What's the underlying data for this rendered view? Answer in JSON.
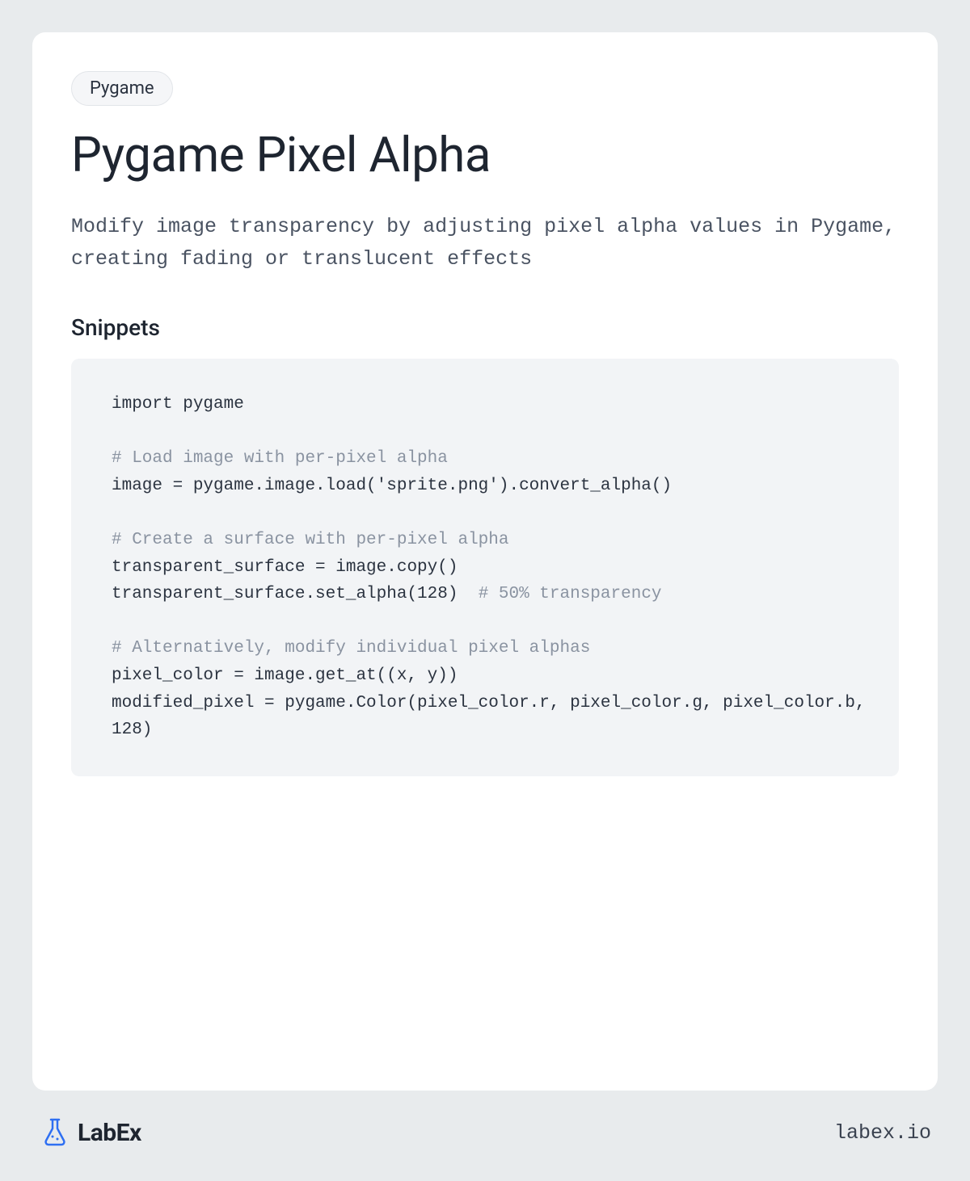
{
  "tag": "Pygame",
  "title": "Pygame Pixel Alpha",
  "description": "Modify image transparency by adjusting pixel alpha values in Pygame, creating fading or translucent effects",
  "section_title": "Snippets",
  "code": {
    "line1": "import pygame",
    "comment1": "# Load image with per-pixel alpha",
    "line2": "image = pygame.image.load('sprite.png').convert_alpha()",
    "comment2": "# Create a surface with per-pixel alpha",
    "line3": "transparent_surface = image.copy()",
    "line4a": "transparent_surface.set_alpha(128)  ",
    "line4b": "# 50% transparency",
    "comment3": "# Alternatively, modify individual pixel alphas",
    "line5": "pixel_color = image.get_at((x, y))",
    "line6": "modified_pixel = pygame.Color(pixel_color.r, pixel_color.g, pixel_color.b, 128)"
  },
  "footer": {
    "brand": "LabEx",
    "url": "labex.io"
  }
}
